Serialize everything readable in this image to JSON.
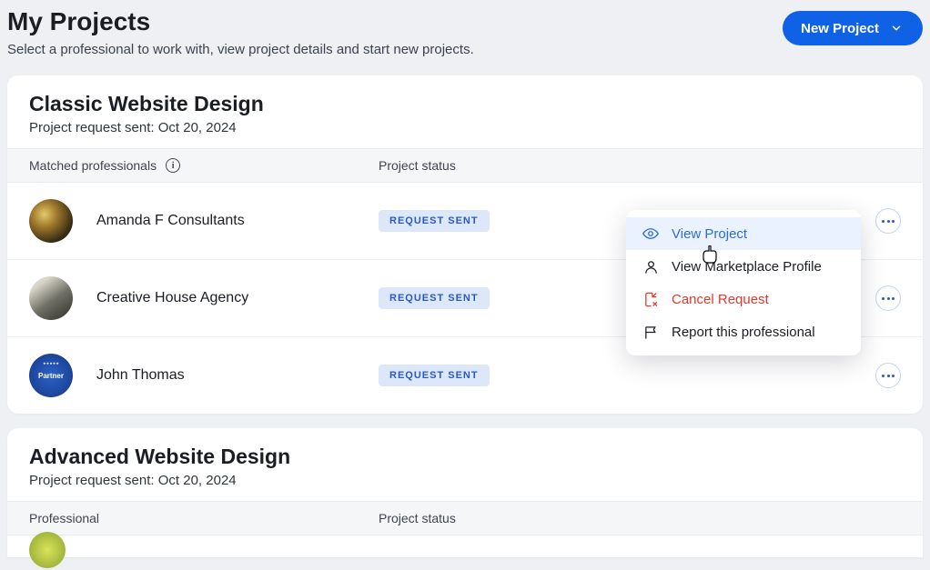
{
  "header": {
    "title": "My Projects",
    "subtitle": "Select a professional to work with, view project details and start new projects.",
    "new_project_label": "New Project"
  },
  "projects": [
    {
      "title": "Classic Website Design",
      "meta": "Project request sent: Oct 20, 2024",
      "col_prof": "Matched professionals",
      "col_status": "Project status",
      "rows": [
        {
          "name": "Amanda F Consultants",
          "status": "REQUEST SENT"
        },
        {
          "name": "Creative House Agency",
          "status": "REQUEST SENT"
        },
        {
          "name": "John Thomas",
          "status": "REQUEST SENT"
        }
      ]
    },
    {
      "title": "Advanced Website Design",
      "meta": "Project request sent: Oct 20, 2024",
      "col_prof": "Professional",
      "col_status": "Project status"
    }
  ],
  "menu": {
    "view_project": "View Project",
    "view_profile": "View Marketplace Profile",
    "cancel_request": "Cancel Request",
    "report": "Report this professional"
  },
  "colors": {
    "primary": "#0f62e6",
    "badge_bg": "#dce8fa",
    "badge_fg": "#2b5abf",
    "danger": "#df3a2f"
  }
}
